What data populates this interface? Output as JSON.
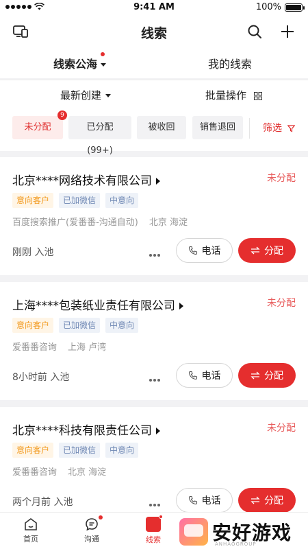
{
  "status_bar": {
    "time": "9:41 AM",
    "battery": "100%"
  },
  "header": {
    "title": "线索"
  },
  "tabs": [
    {
      "label": "线索公海"
    },
    {
      "label": "我的线索"
    }
  ],
  "sort": {
    "newest": "最新创建",
    "batch": "批量操作"
  },
  "filters": {
    "chips": [
      {
        "label": "未分配",
        "badge": "9"
      },
      {
        "label": "已分配(99+)"
      },
      {
        "label": "被收回"
      },
      {
        "label": "销售退回"
      }
    ],
    "filter_label": "筛选"
  },
  "cards": [
    {
      "company": "北京****网络技术有限公司",
      "status": "未分配",
      "tags": [
        "意向客户",
        "已加微信",
        "中意向"
      ],
      "source": "百度搜索推广(爱番番-沟通自动)",
      "location": "北京 海淀",
      "pool_time": "刚刚 入池",
      "call_label": "电话",
      "assign_label": "分配"
    },
    {
      "company": "上海****包装纸业责任有限公司",
      "status": "未分配",
      "tags": [
        "意向客户",
        "已加微信",
        "中意向"
      ],
      "source": "爱番番咨询",
      "location": "上海 卢湾",
      "pool_time": "8小时前 入池",
      "call_label": "电话",
      "assign_label": "分配"
    },
    {
      "company": "北京****科技有限责任公司",
      "status": "未分配",
      "tags": [
        "意向客户",
        "已加微信",
        "中意向"
      ],
      "source": "爱番番咨询",
      "location": "北京 海淀",
      "pool_time": "两个月前 入池",
      "call_label": "电话",
      "assign_label": "分配"
    }
  ],
  "tabbar": {
    "home": "首页",
    "chat": "沟通",
    "leads": "线索"
  },
  "watermark": {
    "text": "安好游戏",
    "sub": "ANHAOGROUP"
  },
  "colors": {
    "accent": "#e52e2e",
    "tag_orange": "#f29a1f",
    "tag_blue": "#6e87b3"
  }
}
